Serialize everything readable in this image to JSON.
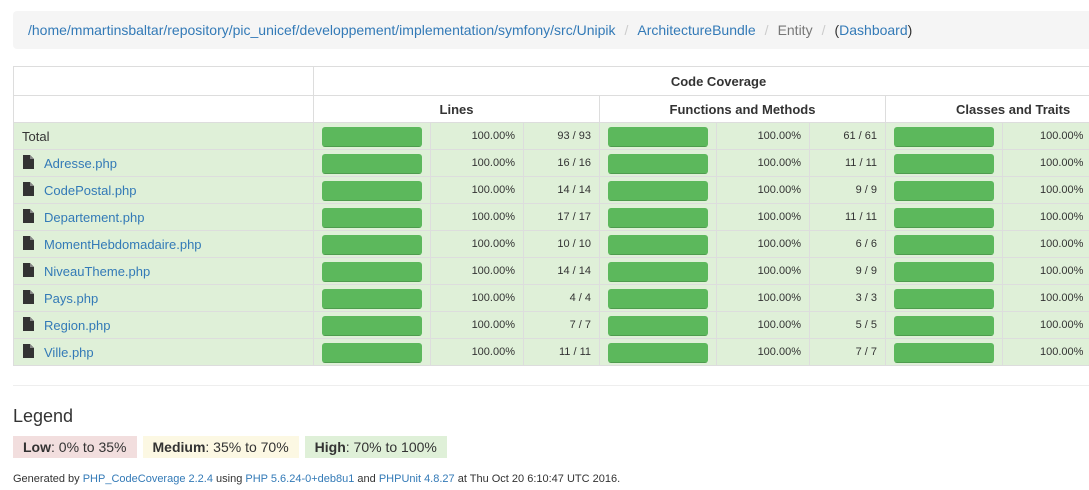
{
  "breadcrumb": {
    "path_link": "/home/mmartinsbaltar/repository/pic_unicef/developpement/implementation/symfony/src/Unipik",
    "separator": "/",
    "bundle_link": "ArchitectureBundle",
    "current": "Entity",
    "dashboard_open": "(",
    "dashboard_link": "Dashboard",
    "dashboard_close": ")"
  },
  "table": {
    "header_code_coverage": "Code Coverage",
    "header_lines": "Lines",
    "header_functions": "Functions and Methods",
    "header_classes": "Classes and Traits",
    "colors": {
      "high": "#dff0d8",
      "bar_success": "#5cb85c"
    },
    "total": {
      "name": "Total",
      "lines": {
        "progress": 100,
        "pct": "100.00%",
        "count": "93 / 93"
      },
      "functions": {
        "progress": 100,
        "pct": "100.00%",
        "count": "61 / 61"
      },
      "classes": {
        "progress": 100,
        "pct": "100.00%"
      }
    },
    "rows": [
      {
        "name": "Adresse.php",
        "icon": "file-icon",
        "lines": {
          "progress": 100,
          "pct": "100.00%",
          "count": "16 / 16"
        },
        "functions": {
          "progress": 100,
          "pct": "100.00%",
          "count": "11 / 11"
        },
        "classes": {
          "progress": 100,
          "pct": "100.00%"
        }
      },
      {
        "name": "CodePostal.php",
        "icon": "file-icon",
        "lines": {
          "progress": 100,
          "pct": "100.00%",
          "count": "14 / 14"
        },
        "functions": {
          "progress": 100,
          "pct": "100.00%",
          "count": "9 / 9"
        },
        "classes": {
          "progress": 100,
          "pct": "100.00%"
        }
      },
      {
        "name": "Departement.php",
        "icon": "file-icon",
        "lines": {
          "progress": 100,
          "pct": "100.00%",
          "count": "17 / 17"
        },
        "functions": {
          "progress": 100,
          "pct": "100.00%",
          "count": "11 / 11"
        },
        "classes": {
          "progress": 100,
          "pct": "100.00%"
        }
      },
      {
        "name": "MomentHebdomadaire.php",
        "icon": "file-icon",
        "lines": {
          "progress": 100,
          "pct": "100.00%",
          "count": "10 / 10"
        },
        "functions": {
          "progress": 100,
          "pct": "100.00%",
          "count": "6 / 6"
        },
        "classes": {
          "progress": 100,
          "pct": "100.00%"
        }
      },
      {
        "name": "NiveauTheme.php",
        "icon": "file-icon",
        "lines": {
          "progress": 100,
          "pct": "100.00%",
          "count": "14 / 14"
        },
        "functions": {
          "progress": 100,
          "pct": "100.00%",
          "count": "9 / 9"
        },
        "classes": {
          "progress": 100,
          "pct": "100.00%"
        }
      },
      {
        "name": "Pays.php",
        "icon": "file-icon",
        "lines": {
          "progress": 100,
          "pct": "100.00%",
          "count": "4 / 4"
        },
        "functions": {
          "progress": 100,
          "pct": "100.00%",
          "count": "3 / 3"
        },
        "classes": {
          "progress": 100,
          "pct": "100.00%"
        }
      },
      {
        "name": "Region.php",
        "icon": "file-icon",
        "lines": {
          "progress": 100,
          "pct": "100.00%",
          "count": "7 / 7"
        },
        "functions": {
          "progress": 100,
          "pct": "100.00%",
          "count": "5 / 5"
        },
        "classes": {
          "progress": 100,
          "pct": "100.00%"
        }
      },
      {
        "name": "Ville.php",
        "icon": "file-icon",
        "lines": {
          "progress": 100,
          "pct": "100.00%",
          "count": "11 / 11"
        },
        "functions": {
          "progress": 100,
          "pct": "100.00%",
          "count": "7 / 7"
        },
        "classes": {
          "progress": 100,
          "pct": "100.00%"
        }
      }
    ]
  },
  "legend": {
    "title": "Legend",
    "low_label": "Low",
    "low_range": ": 0% to 35%",
    "medium_label": "Medium",
    "medium_range": ": 35% to 70%",
    "high_label": "High",
    "high_range": ": 70% to 100%",
    "colors": {
      "low": "#f2dede",
      "medium": "#fcf8e3",
      "high": "#dff0d8"
    }
  },
  "footer": {
    "generated_by": "Generated by ",
    "codecoverage_link": "PHP_CodeCoverage 2.2.4",
    "using": " using ",
    "php_link": "PHP 5.6.24-0+deb8u1",
    "and": " and ",
    "phpunit_link": "PHPUnit 4.8.27",
    "timestamp": " at Thu Oct 20 6:10:47 UTC 2016."
  }
}
